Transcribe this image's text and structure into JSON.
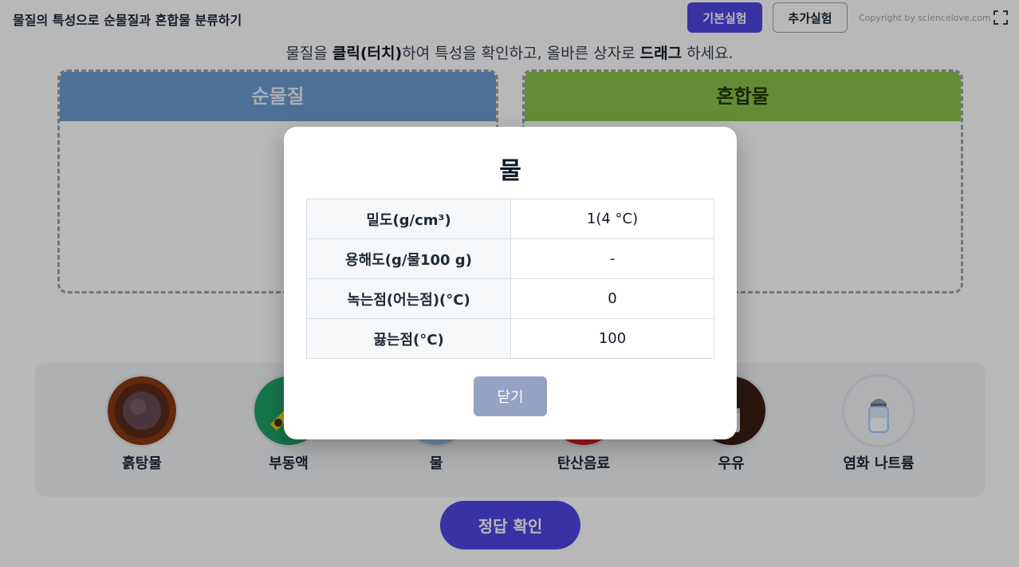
{
  "header": {
    "title": "물질의 특성으로 순물질과 혼합물 분류하기",
    "basic_button": "기본실험",
    "extra_button": "추가실험",
    "copyright": "Copyright by sciencelove.com",
    "fullscreen_icon": "fullscreen-icon"
  },
  "instruction": {
    "part1": "물질을 ",
    "bold1": "클릭(터치)",
    "part2": "하여 특성을 확인하고, 올바른 상자로 ",
    "bold2": "드래그",
    "part3": " 하세요."
  },
  "boxes": {
    "pure_label": "순물질",
    "mixture_label": "혼합물"
  },
  "items": [
    {
      "label": "흙탕물",
      "icon": "muddy-water-icon"
    },
    {
      "label": "부동액",
      "icon": "antifreeze-icon"
    },
    {
      "label": "물",
      "icon": "water-icon"
    },
    {
      "label": "탄산음료",
      "icon": "soda-icon"
    },
    {
      "label": "우유",
      "icon": "milk-icon"
    },
    {
      "label": "염화 나트륨",
      "icon": "salt-shaker-icon"
    }
  ],
  "check_button": "정답 확인",
  "modal": {
    "title": "물",
    "rows": [
      {
        "key": "밀도(g/cm³)",
        "value": "1(4 °C)"
      },
      {
        "key": "용해도(g/물100 g)",
        "value": "-"
      },
      {
        "key": "녹는점(어는점)(°C)",
        "value": "0"
      },
      {
        "key": "끓는점(°C)",
        "value": "100"
      }
    ],
    "close_button": "닫기"
  },
  "colors": {
    "accent": "#4f46e5",
    "pure_header": "#6b9bd2",
    "mixture_header": "#8bc34a",
    "close_button": "#94a3c4"
  }
}
